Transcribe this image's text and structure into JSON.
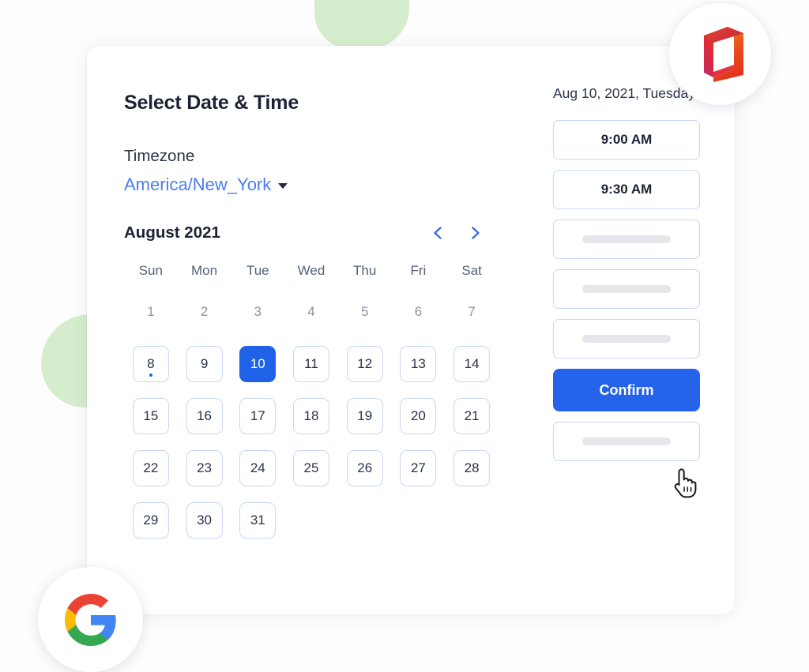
{
  "page": {
    "title": "Select Date & Time"
  },
  "timezone": {
    "label": "Timezone",
    "value": "America/New_York",
    "caret_icon": "chevron-down-icon"
  },
  "calendar": {
    "month_label": "August 2021",
    "prev_icon": "chevron-left-icon",
    "next_icon": "chevron-right-icon",
    "weekdays": [
      "Sun",
      "Mon",
      "Tue",
      "Wed",
      "Thu",
      "Fri",
      "Sat"
    ],
    "days": [
      {
        "label": "1",
        "state": "disabled"
      },
      {
        "label": "2",
        "state": "disabled"
      },
      {
        "label": "3",
        "state": "disabled"
      },
      {
        "label": "4",
        "state": "disabled"
      },
      {
        "label": "5",
        "state": "disabled"
      },
      {
        "label": "6",
        "state": "disabled"
      },
      {
        "label": "7",
        "state": "disabled"
      },
      {
        "label": "8",
        "state": "enabled",
        "today": true
      },
      {
        "label": "9",
        "state": "enabled"
      },
      {
        "label": "10",
        "state": "selected"
      },
      {
        "label": "11",
        "state": "enabled"
      },
      {
        "label": "12",
        "state": "enabled"
      },
      {
        "label": "13",
        "state": "enabled"
      },
      {
        "label": "14",
        "state": "enabled"
      },
      {
        "label": "15",
        "state": "enabled"
      },
      {
        "label": "16",
        "state": "enabled"
      },
      {
        "label": "17",
        "state": "enabled"
      },
      {
        "label": "18",
        "state": "enabled"
      },
      {
        "label": "19",
        "state": "enabled"
      },
      {
        "label": "20",
        "state": "enabled"
      },
      {
        "label": "21",
        "state": "enabled"
      },
      {
        "label": "22",
        "state": "enabled"
      },
      {
        "label": "23",
        "state": "enabled"
      },
      {
        "label": "24",
        "state": "enabled"
      },
      {
        "label": "25",
        "state": "enabled"
      },
      {
        "label": "26",
        "state": "enabled"
      },
      {
        "label": "27",
        "state": "enabled"
      },
      {
        "label": "28",
        "state": "enabled"
      },
      {
        "label": "29",
        "state": "enabled"
      },
      {
        "label": "30",
        "state": "enabled"
      },
      {
        "label": "31",
        "state": "enabled"
      }
    ]
  },
  "slots_panel": {
    "selected_date": "Aug 10, 2021, Tuesday",
    "slots": [
      {
        "type": "time",
        "label": "9:00 AM"
      },
      {
        "type": "time",
        "label": "9:30 AM"
      },
      {
        "type": "skeleton",
        "label": ""
      },
      {
        "type": "skeleton",
        "label": ""
      },
      {
        "type": "skeleton",
        "label": ""
      },
      {
        "type": "confirm",
        "label": "Confirm"
      },
      {
        "type": "skeleton",
        "label": ""
      }
    ]
  },
  "badges": [
    {
      "name": "microsoft-office-logo"
    },
    {
      "name": "google-logo"
    }
  ],
  "cursor": {
    "icon": "pointing-hand-cursor"
  },
  "colors": {
    "accent_blue": "#2563eb",
    "selected_blue": "#1f62e8",
    "link_blue": "#4a7df0",
    "border_blue": "#c7d7f5",
    "text_dark": "#1a2234",
    "text_muted": "#8a93a8",
    "skeleton_grey": "#e6e7ea",
    "blob_green": "#cfeac4"
  }
}
